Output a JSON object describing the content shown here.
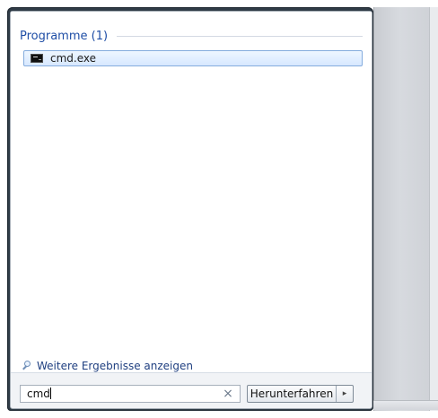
{
  "results": {
    "section_title": "Programme (1)",
    "items": [
      {
        "label": "cmd.exe",
        "icon": "command-prompt-icon"
      }
    ],
    "more_results_label": "Weitere Ergebnisse anzeigen"
  },
  "search": {
    "value": "cmd",
    "clear_symbol": "×"
  },
  "power": {
    "shutdown_label": "Herunterfahren",
    "arrow_symbol": "▸"
  }
}
